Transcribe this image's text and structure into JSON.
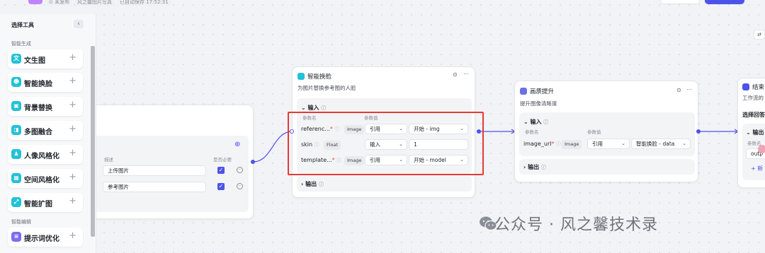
{
  "header": {
    "status": "⊙ 未发布",
    "workflow_name": "风之馨图片写真",
    "autosave": "已自动保存 17:52:31"
  },
  "sidebar": {
    "title": "选择工具",
    "collapse_icon": "‹",
    "section_generation": "智能生成",
    "section_editing": "智能编辑",
    "tools": [
      {
        "label": "文生图",
        "color": "#22c1d6",
        "icon": "文"
      },
      {
        "label": "智能换脸",
        "color": "#22c1d6",
        "icon": "☻"
      },
      {
        "label": "背景替换",
        "color": "#22c1d6",
        "icon": "▣"
      },
      {
        "label": "多图融合",
        "color": "#22c1d6",
        "icon": "◨"
      },
      {
        "label": "人像风格化",
        "color": "#22c1d6",
        "icon": "♟"
      },
      {
        "label": "空间风格化",
        "color": "#22c1d6",
        "icon": "▦"
      },
      {
        "label": "智能扩图",
        "color": "#22c1d6",
        "icon": "⤢"
      },
      {
        "label": "提示词优化",
        "color": "#7c6cf0",
        "icon": "≡"
      }
    ],
    "plus": "+"
  },
  "start_node": {
    "col_desc": "描述",
    "col_required": "是否必要",
    "rows": [
      {
        "desc": "上传图片"
      },
      {
        "desc": "参考图片"
      }
    ],
    "add_icon": "⊕"
  },
  "faceswap_node": {
    "title": "智能换脸",
    "description": "为图片替换参考图的人脸",
    "input_label": "输入",
    "output_label": "输出",
    "col_param": "参数名",
    "col_value": "参数值",
    "params": [
      {
        "name": "referenc...",
        "required": "*",
        "type": "Image",
        "mode": "引用",
        "value": "开始 - img"
      },
      {
        "name": "skin",
        "required": "",
        "type": "Float",
        "mode": "输入",
        "value": "1"
      },
      {
        "name": "template...",
        "required": "*",
        "type": "Image",
        "mode": "引用",
        "value": "开始 - model"
      }
    ]
  },
  "enhance_node": {
    "title": "画质提升",
    "description": "提升图像清晰度",
    "input_label": "输入",
    "output_label": "输出",
    "col_param": "参数名",
    "col_value": "参数值",
    "params": [
      {
        "name": "image_url",
        "required": "*",
        "type": "Image",
        "mode": "引用",
        "value": "智能换脸 - data"
      }
    ]
  },
  "end_node": {
    "title": "结束",
    "description": "工作流的",
    "answer_label": "选择回答",
    "output_label": "输出",
    "col_param": "参数名",
    "output_value": "outp",
    "add": "+ 新"
  },
  "watermark": {
    "text": "公众号 · 风之馨技术录"
  },
  "edge_button": "⇄"
}
